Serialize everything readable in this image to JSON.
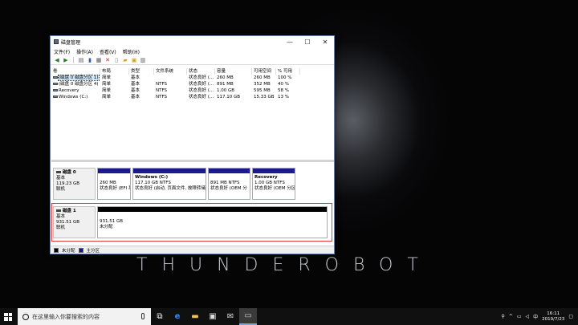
{
  "desktop": {
    "wordmark": "THUNDEROBOT"
  },
  "window": {
    "title": "磁盘管理",
    "controls": {
      "minimize": "—",
      "maximize": "☐",
      "close": "✕"
    },
    "menu": [
      "文件(F)",
      "操作(A)",
      "查看(V)",
      "帮助(H)"
    ],
    "toolbar_icons": [
      "back-icon",
      "forward-icon",
      "list-icon",
      "help-icon",
      "grid-icon",
      "delete-icon",
      "properties-icon",
      "folder-icon",
      "expand-icon",
      "view-icon"
    ]
  },
  "volume_table": {
    "columns": [
      "卷",
      "布局",
      "类型",
      "文件系统",
      "状态",
      "容量",
      "可用空间",
      "% 可用"
    ],
    "rows": [
      {
        "volume": "(磁盘 0 磁盘分区 1)",
        "layout": "简单",
        "type": "基本",
        "fs": "",
        "status": "状态良好 (...",
        "capacity": "260 MB",
        "free": "260 MB",
        "pct": "100 %",
        "selected": true
      },
      {
        "volume": "(磁盘 0 磁盘分区 4)",
        "layout": "简单",
        "type": "基本",
        "fs": "NTFS",
        "status": "状态良好 (...",
        "capacity": "891 MB",
        "free": "352 MB",
        "pct": "40 %",
        "selected": false
      },
      {
        "volume": "Recovery",
        "layout": "简单",
        "type": "基本",
        "fs": "NTFS",
        "status": "状态良好 (...",
        "capacity": "1.00 GB",
        "free": "595 MB",
        "pct": "58 %",
        "selected": false
      },
      {
        "volume": "Windows (C:)",
        "layout": "简单",
        "type": "基本",
        "fs": "NTFS",
        "status": "状态良好 (...",
        "capacity": "117.10 GB",
        "free": "15.33 GB",
        "pct": "13 %",
        "selected": false
      }
    ]
  },
  "disks": [
    {
      "name": "磁盘 0",
      "type": "基本",
      "size": "119.23 GB",
      "state": "联机",
      "partitions": [
        {
          "name": "",
          "size": "260 MB",
          "desc": "状态良好 (EFI 系"
        },
        {
          "name": "Windows (C:)",
          "size": "117.10 GB NTFS",
          "desc": "状态良好 (启动, 页面文件, 故障转储"
        },
        {
          "name": "",
          "size": "891 MB NTFS",
          "desc": "状态良好 (OEM 分"
        },
        {
          "name": "Recovery",
          "size": "1.00 GB NTFS",
          "desc": "状态良好 (OEM 分区"
        }
      ]
    },
    {
      "name": "磁盘 1",
      "type": "基本",
      "size": "931.51 GB",
      "state": "联机",
      "partitions": [
        {
          "name": "",
          "size": "931.51 GB",
          "desc": "未分配"
        }
      ]
    }
  ],
  "legend": [
    {
      "label": "未分配",
      "color": "#000000"
    },
    {
      "label": "主分区",
      "color": "#1a1a8c"
    }
  ],
  "taskbar": {
    "search_placeholder": "在这里输入你要搜索的内容",
    "time": "16:11",
    "date": "2019/7/23",
    "ime": "中"
  },
  "colors": {
    "highlight_border": "#e53939",
    "partition_header": "#1a1a8c"
  }
}
